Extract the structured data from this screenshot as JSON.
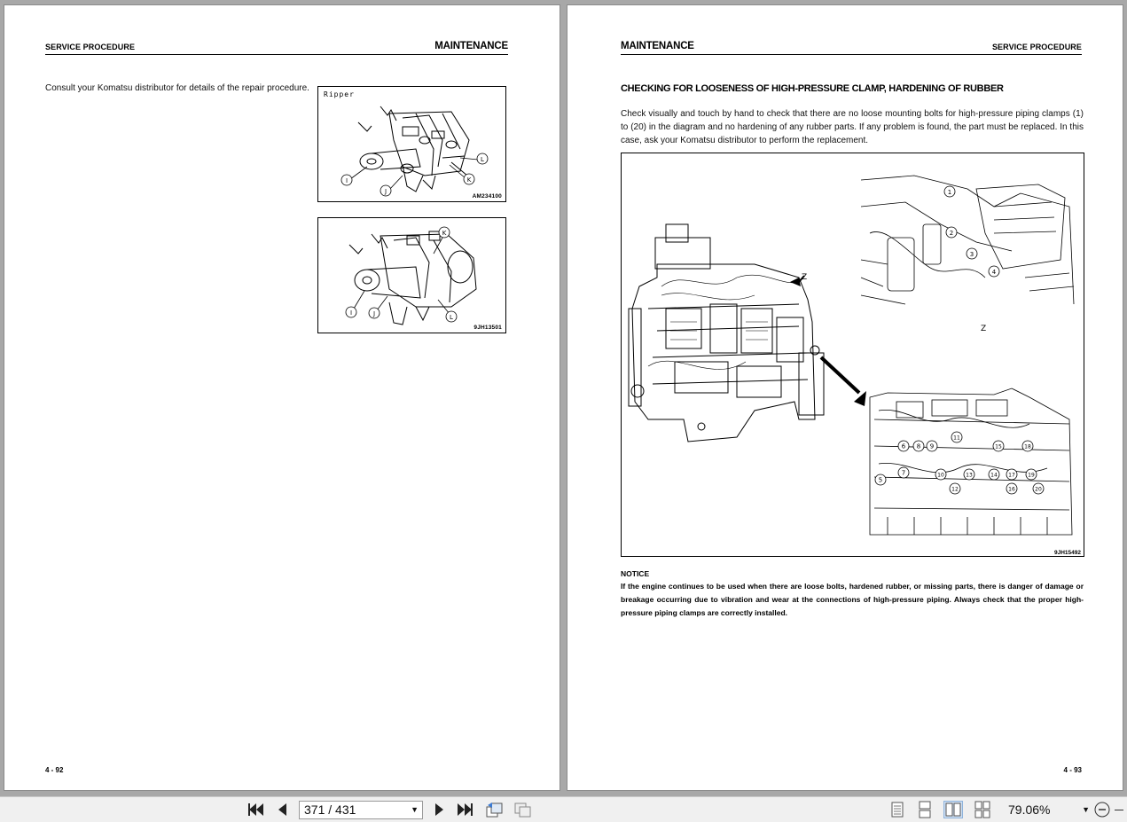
{
  "left_page": {
    "header_left": "SERVICE PROCEDURE",
    "header_right": "MAINTENANCE",
    "body": "Consult your Komatsu distributor for details of the repair procedure.",
    "figure1": {
      "label": "Ripper",
      "code": "AM234100",
      "callouts": [
        "I",
        "J",
        "K",
        "L"
      ]
    },
    "figure2": {
      "code": "9JH13501",
      "callouts": [
        "I",
        "J",
        "K",
        "L"
      ]
    },
    "page_number": "4 - 92"
  },
  "right_page": {
    "header_left": "MAINTENANCE",
    "header_right": "SERVICE PROCEDURE",
    "section_title": "CHECKING FOR LOOSENESS OF HIGH-PRESSURE CLAMP, HARDENING OF RUBBER",
    "body": "Check visually and touch by hand to check that there are no loose mounting bolts for high-pressure piping clamps (1) to (20) in the diagram and no hardening of any rubber parts. If any problem is found, the part must be replaced. In this case, ask your Komatsu distributor to perform the replacement.",
    "figure": {
      "code": "9JH15492",
      "view_label": "Z",
      "arrow_label": "Z",
      "callouts_top": [
        "1",
        "2",
        "3",
        "4"
      ],
      "callouts_bottom": [
        "5",
        "6",
        "7",
        "8",
        "9",
        "10",
        "11",
        "12",
        "13",
        "14",
        "15",
        "16",
        "17",
        "18",
        "19",
        "20"
      ]
    },
    "notice_title": "NOTICE",
    "notice_text": "If the engine continues to be used when there are loose bolts, hardened rubber, or missing parts, there is danger of damage or breakage occurring due to vibration and wear at the connections of high-pressure piping.  Always check that the  proper high-pressure piping clamps are correctly installed.",
    "page_number": "4 - 93"
  },
  "toolbar": {
    "page_indicator": "371 / 431",
    "zoom": "79.06%",
    "icons": [
      "first-page-icon",
      "previous-page-icon",
      "next-page-icon",
      "last-page-icon",
      "rotate-icon",
      "snapshot-icon",
      "single-page-icon",
      "continuous-page-icon",
      "facing-page-icon",
      "continuous-facing-icon",
      "zoom-out-icon"
    ]
  }
}
